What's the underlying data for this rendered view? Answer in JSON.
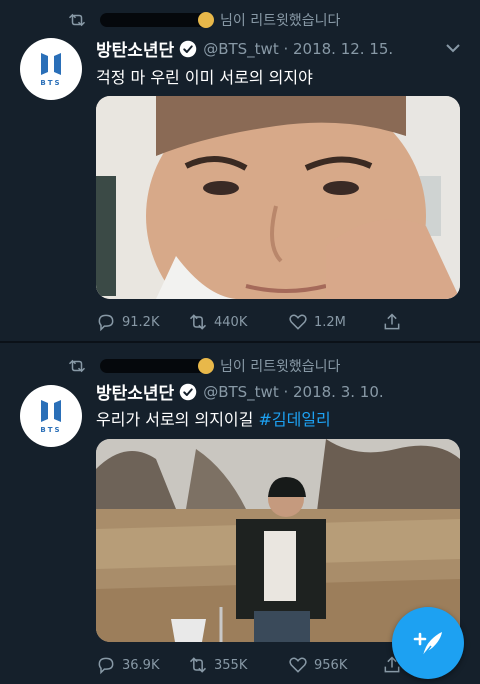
{
  "theme": {
    "background": "#15202b",
    "accent": "#1da1f2",
    "muted": "#8899a6",
    "verified": "#ffffff"
  },
  "tweets": [
    {
      "retweet_text": "님이 리트윗했습니다",
      "display_name": "방탄소년단",
      "handle_date": "@BTS_twt · 2018. 12. 15.",
      "text": "걱정 마 우린 이미 서로의 의지야",
      "hashtag": "",
      "media_icon": "selfie-photo",
      "reply_count": "91.2K",
      "retweet_count": "440K",
      "like_count": "1.2M"
    },
    {
      "retweet_text": "님이 리트윗했습니다",
      "display_name": "방탄소년단",
      "handle_date": "@BTS_twt · 2018. 3. 10.",
      "text": "우리가 서로의 의지이길 ",
      "hashtag": "#김데일리",
      "media_icon": "field-photo",
      "reply_count": "36.9K",
      "retweet_count": "355K",
      "like_count": "956K"
    }
  ],
  "avatar": {
    "logo_text": "BTS",
    "logo_color": "#2a6fb8"
  },
  "fab": {
    "icon": "compose-tweet-icon"
  }
}
